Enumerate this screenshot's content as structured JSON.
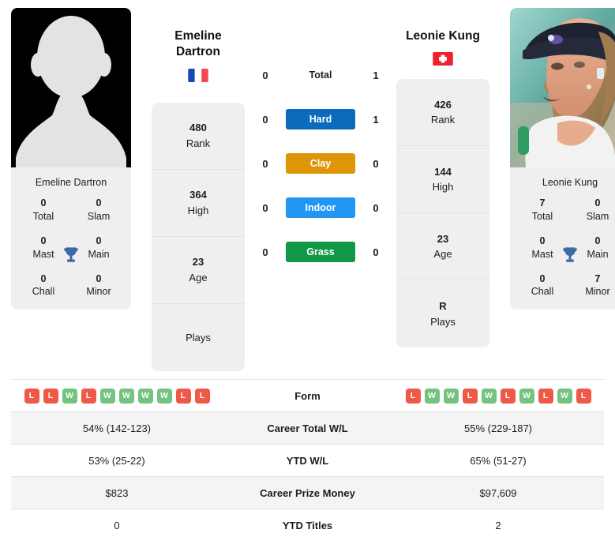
{
  "colors": {
    "hard": "#0b6cbd",
    "clay": "#de9508",
    "indoor": "#2196f3",
    "grass": "#109848",
    "win": "#74c37e",
    "loss": "#ee5a47",
    "trophy": "#3a6ba5"
  },
  "player_left": {
    "name_line1": "Emeline",
    "name_line2": "Dartron",
    "photo_caption": "Emeline Dartron",
    "country": "France",
    "flag": "fr",
    "titles": [
      {
        "value": "0",
        "label": "Total"
      },
      {
        "value": "0",
        "label": "Slam"
      },
      {
        "value": "0",
        "label": "Mast"
      },
      {
        "value": "0",
        "label": "Main"
      },
      {
        "value": "0",
        "label": "Chall"
      },
      {
        "value": "0",
        "label": "Minor"
      }
    ],
    "info": [
      {
        "value": "480",
        "caption": "Rank"
      },
      {
        "value": "364",
        "caption": "High"
      },
      {
        "value": "23",
        "caption": "Age"
      },
      {
        "value": "",
        "caption": "Plays"
      }
    ],
    "surface_values": {
      "total": "0",
      "hard": "0",
      "clay": "0",
      "indoor": "0",
      "grass": "0"
    },
    "form": [
      "L",
      "L",
      "W",
      "L",
      "W",
      "W",
      "W",
      "W",
      "L",
      "L"
    ],
    "career_total_wl": "54% (142-123)",
    "ytd_wl": "53% (25-22)",
    "career_prize_money": "$823",
    "ytd_titles": "0"
  },
  "player_right": {
    "name_line1": "Leonie Kung",
    "name_line2": "",
    "photo_caption": "Leonie Kung",
    "country": "Switzerland",
    "flag": "ch",
    "titles": [
      {
        "value": "7",
        "label": "Total"
      },
      {
        "value": "0",
        "label": "Slam"
      },
      {
        "value": "0",
        "label": "Mast"
      },
      {
        "value": "0",
        "label": "Main"
      },
      {
        "value": "0",
        "label": "Chall"
      },
      {
        "value": "7",
        "label": "Minor"
      }
    ],
    "info": [
      {
        "value": "426",
        "caption": "Rank"
      },
      {
        "value": "144",
        "caption": "High"
      },
      {
        "value": "23",
        "caption": "Age"
      },
      {
        "value": "R",
        "caption": "Plays"
      }
    ],
    "surface_values": {
      "total": "1",
      "hard": "1",
      "clay": "0",
      "indoor": "0",
      "grass": "0"
    },
    "form": [
      "L",
      "W",
      "W",
      "L",
      "W",
      "L",
      "W",
      "L",
      "W",
      "L"
    ],
    "career_total_wl": "55% (229-187)",
    "ytd_wl": "65% (51-27)",
    "career_prize_money": "$97,609",
    "ytd_titles": "2"
  },
  "surfaces": [
    {
      "key": "total",
      "label": "Total",
      "style": "plain"
    },
    {
      "key": "hard",
      "label": "Hard",
      "style": "hard"
    },
    {
      "key": "clay",
      "label": "Clay",
      "style": "clay"
    },
    {
      "key": "indoor",
      "label": "Indoor",
      "style": "indoor"
    },
    {
      "key": "grass",
      "label": "Grass",
      "style": "grass"
    }
  ],
  "table_rows": [
    {
      "label": "Form",
      "type": "form"
    },
    {
      "label": "Career Total W/L",
      "type": "text"
    },
    {
      "label": "YTD W/L",
      "type": "text"
    },
    {
      "label": "Career Prize Money",
      "type": "text"
    },
    {
      "label": "YTD Titles",
      "type": "text"
    }
  ]
}
